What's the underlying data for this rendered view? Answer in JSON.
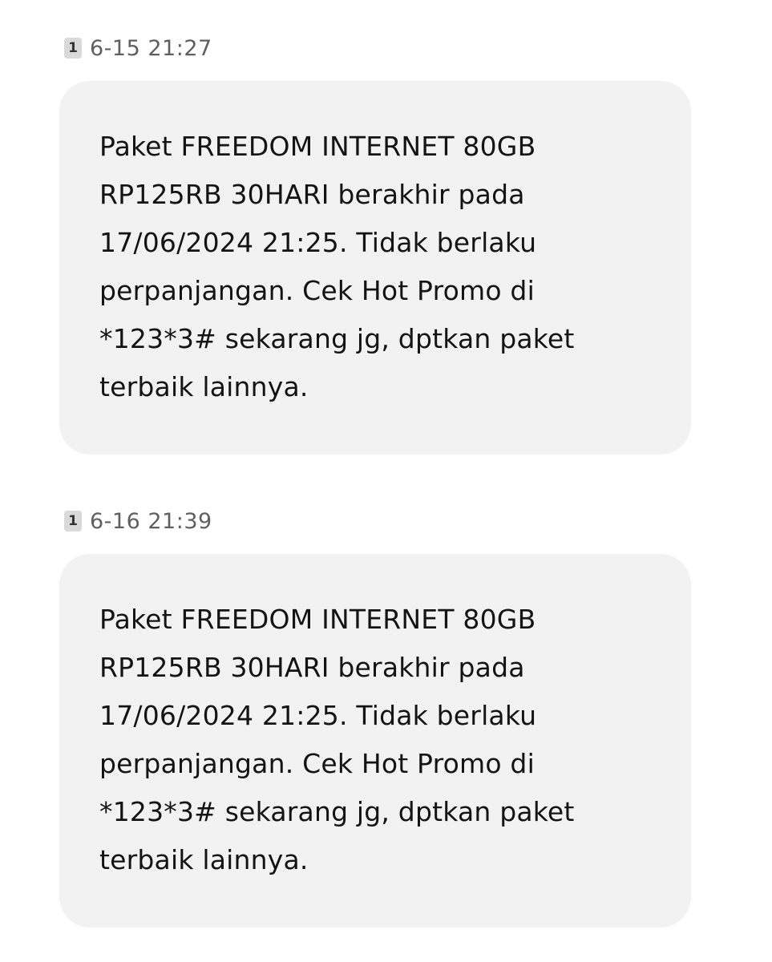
{
  "messages": [
    {
      "sim": "1",
      "timestamp": "6-15 21:27",
      "text": "Paket FREEDOM INTERNET 80GB\nRP125RB 30HARI berakhir pada\n17/06/2024 21:25. Tidak berlaku\nperpanjangan. Cek Hot Promo di\n*123*3# sekarang jg, dptkan paket\nterbaik lainnya."
    },
    {
      "sim": "1",
      "timestamp": "6-16 21:39",
      "text": "Paket FREEDOM INTERNET 80GB\nRP125RB 30HARI berakhir pada\n17/06/2024 21:25. Tidak berlaku\nperpanjangan. Cek Hot Promo di\n*123*3# sekarang jg, dptkan paket\nterbaik lainnya."
    }
  ],
  "colors": {
    "background": "#ffffff",
    "bubble": "#f2f2f2",
    "text": "#141414",
    "timestamp": "#5f5f5f",
    "sim_badge": "#d9d9d9"
  },
  "icons": {
    "sim_badge": "sim-card-1-icon"
  }
}
